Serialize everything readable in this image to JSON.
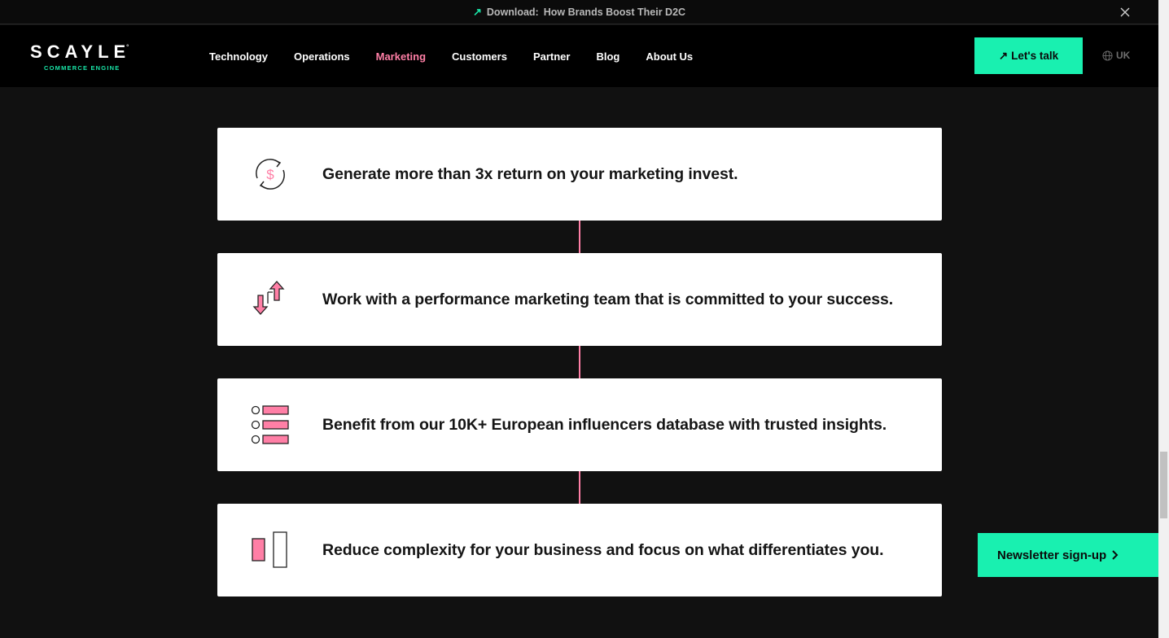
{
  "announcement": {
    "prefix": "Download:",
    "text": "How Brands Boost Their D2C"
  },
  "logo": {
    "word": "SCAYLE",
    "subtitle": "COMMERCE ENGINE"
  },
  "nav": {
    "items": [
      {
        "label": "Technology"
      },
      {
        "label": "Operations"
      },
      {
        "label": "Marketing",
        "active": true
      },
      {
        "label": "Customers"
      },
      {
        "label": "Partner"
      },
      {
        "label": "Blog"
      },
      {
        "label": "About Us"
      }
    ]
  },
  "header": {
    "cta_label": "Let's talk",
    "lang_label": "UK"
  },
  "cards": [
    {
      "icon": "dollar-cycle-icon",
      "text": "Generate more than 3x return on your marketing invest."
    },
    {
      "icon": "up-down-arrows-icon",
      "text": "Work with a performance marketing team that is committed to your success."
    },
    {
      "icon": "list-database-icon",
      "text": "Benefit from our 10K+ European influencers database with trusted insights."
    },
    {
      "icon": "focus-bars-icon",
      "text": "Reduce complexity for your business and focus on what differentiates you."
    }
  ],
  "newsletter": {
    "label": "Newsletter sign-up"
  },
  "colors": {
    "accent": "#19f0b0",
    "highlight": "#ff7fa6",
    "background": "#111111"
  }
}
